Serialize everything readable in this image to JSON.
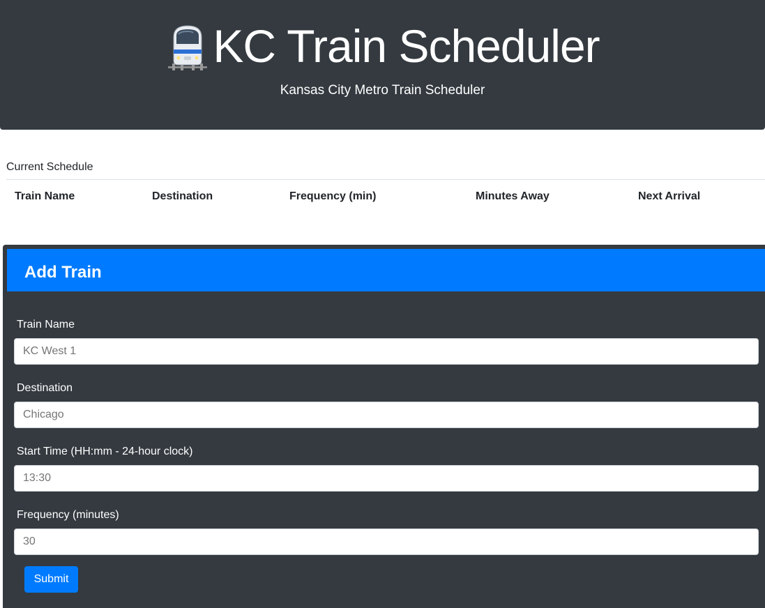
{
  "header": {
    "title": "KC Train Scheduler",
    "subtitle": "Kansas City Metro Train Scheduler",
    "icon": "train-icon"
  },
  "schedule": {
    "caption": "Current Schedule",
    "columns": [
      "Train Name",
      "Destination",
      "Frequency (min)",
      "Minutes Away",
      "Next Arrival"
    ]
  },
  "form": {
    "title": "Add Train",
    "fields": [
      {
        "label": "Train Name",
        "placeholder": "KC West 1"
      },
      {
        "label": "Destination",
        "placeholder": "Chicago"
      },
      {
        "label": "Start Time (HH:mm - 24-hour clock)",
        "placeholder": "13:30"
      },
      {
        "label": "Frequency (minutes)",
        "placeholder": "30"
      }
    ],
    "submit_label": "Submit"
  },
  "colors": {
    "dark_bg": "#343a40",
    "primary": "#007bff"
  }
}
